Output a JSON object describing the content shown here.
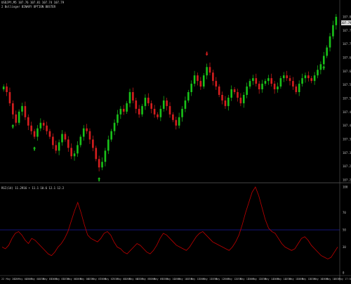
{
  "header": {
    "symbol_line": "USDJPY,M5 107.76 107.81 107.74 107.79",
    "indicator_line": "2 Bollinger BINARY OPTION BUSTER"
  },
  "lower_pane": {
    "title": "RSI(14) 11.2916 • 11.1 10.6 12.1 12.2"
  },
  "price_axis": {
    "labels": [
      "107.80",
      "107.75",
      "107.70",
      "107.65",
      "107.60",
      "107.55",
      "107.50",
      "107.45",
      "107.40",
      "107.35",
      "107.30",
      "107.25",
      "107.20"
    ],
    "current_price": "107.79"
  },
  "rsi_axis": {
    "labels": [
      "100",
      "70",
      "50",
      "30",
      "0"
    ]
  },
  "time_axis": {
    "labels": [
      "22 May 2020",
      "22 May 04:00",
      "22 May 04:30",
      "22 May 05:00",
      "22 May 05:30",
      "22 May 06:00",
      "22 May 06:30",
      "22 May 07:00",
      "22 May 07:30",
      "22 May 08:00",
      "22 May 08:30",
      "22 May 09:00",
      "22 May 09:30",
      "22 May 10:00",
      "22 May 10:30",
      "22 May 11:00",
      "22 May 11:30",
      "22 May 12:00",
      "22 May 12:30",
      "22 May 13:00",
      "22 May 13:30",
      "22 May 14:00",
      "22 May 14:30",
      "22 May 15:00",
      "22 May 15:30",
      "22 May 16:00",
      "22 May 16:30",
      "22 May 17:00"
    ]
  },
  "colors": {
    "bull": "#19c219",
    "bear": "#d61e1e",
    "rsi_line": "#c00000",
    "level_line": "#1a1aa0",
    "grid": "#1a1a1a",
    "separator": "#5a5a5a",
    "axis_text": "#bfbfbf"
  },
  "chart_data": [
    {
      "type": "candlestick",
      "title": "USDJPY,M5",
      "ylim": [
        107.2,
        107.82
      ],
      "series": [
        {
          "name": "price",
          "close": [
            107.54,
            107.52,
            107.48,
            107.44,
            107.41,
            107.45,
            107.47,
            107.43,
            107.4,
            107.38,
            107.36,
            107.39,
            107.41,
            107.4,
            107.38,
            107.36,
            107.33,
            107.31,
            107.34,
            107.37,
            107.35,
            107.32,
            107.29,
            107.3,
            107.33,
            107.36,
            107.39,
            107.38,
            107.35,
            107.32,
            107.28,
            107.25,
            107.27,
            107.31,
            107.35,
            107.38,
            107.41,
            107.44,
            107.46,
            107.45,
            107.48,
            107.52,
            107.49,
            107.46,
            107.44,
            107.47,
            107.5,
            107.48,
            107.46,
            107.44,
            107.43,
            107.46,
            107.49,
            107.47,
            107.44,
            107.42,
            107.4,
            107.43,
            107.46,
            107.49,
            107.52,
            107.55,
            107.58,
            107.56,
            107.54,
            107.58,
            107.61,
            107.59,
            107.56,
            107.54,
            107.51,
            107.49,
            107.47,
            107.5,
            107.53,
            107.52,
            107.5,
            107.48,
            107.51,
            107.54,
            107.56,
            107.57,
            107.55,
            107.53,
            107.55,
            107.56,
            107.57,
            107.55,
            107.53,
            107.54,
            107.57,
            107.58,
            107.57,
            107.56,
            107.54,
            107.52,
            107.55,
            107.57,
            107.58,
            107.57,
            107.56,
            107.58,
            107.6,
            107.62,
            107.65,
            107.68,
            107.72,
            107.76,
            107.79
          ]
        }
      ]
    },
    {
      "type": "line",
      "title": "RSI(14)",
      "ylim": [
        0,
        100
      ],
      "series": [
        {
          "name": "RSI",
          "values": [
            30,
            28,
            32,
            40,
            46,
            48,
            44,
            38,
            34,
            40,
            38,
            34,
            30,
            26,
            22,
            20,
            24,
            30,
            34,
            40,
            48,
            60,
            72,
            82,
            70,
            56,
            44,
            40,
            38,
            36,
            40,
            46,
            48,
            44,
            36,
            30,
            28,
            24,
            22,
            26,
            30,
            34,
            32,
            28,
            24,
            22,
            26,
            32,
            40,
            46,
            44,
            40,
            36,
            32,
            30,
            28,
            26,
            30,
            36,
            42,
            46,
            48,
            44,
            40,
            36,
            34,
            32,
            30,
            28,
            26,
            30,
            36,
            44,
            56,
            70,
            82,
            94,
            100,
            90,
            76,
            62,
            52,
            48,
            46,
            40,
            34,
            30,
            28,
            26,
            28,
            34,
            40,
            42,
            38,
            32,
            28,
            24,
            20,
            18,
            16,
            18,
            24,
            30
          ]
        }
      ]
    }
  ]
}
